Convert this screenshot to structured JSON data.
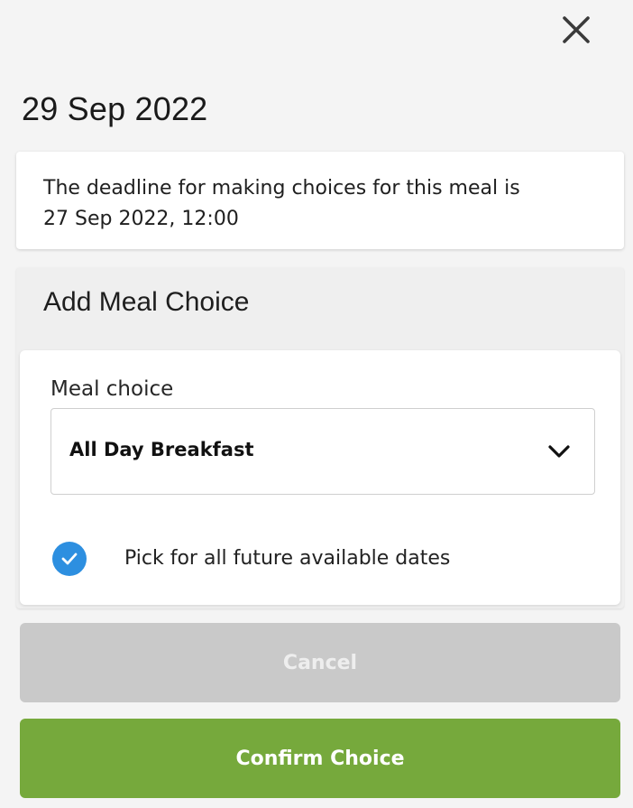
{
  "header": {
    "close_icon": "close-icon",
    "date": "29 Sep 2022"
  },
  "deadline": {
    "line1": "The deadline for making choices for this meal is",
    "line2": "27 Sep 2022, 12:00"
  },
  "meal_panel": {
    "title": "Add Meal Choice",
    "field_label": "Meal choice",
    "selected_value": "All Day Breakfast",
    "dropdown_icon": "chevron-down-icon",
    "checkbox_checked": true,
    "checkbox_label": "Pick for all future available dates"
  },
  "actions": {
    "cancel_label": "Cancel",
    "confirm_label": "Confirm Choice"
  },
  "colors": {
    "checkbox": "#2d8fe0",
    "cancel_bg": "#c9c9c9",
    "confirm_bg": "#76a93c"
  }
}
